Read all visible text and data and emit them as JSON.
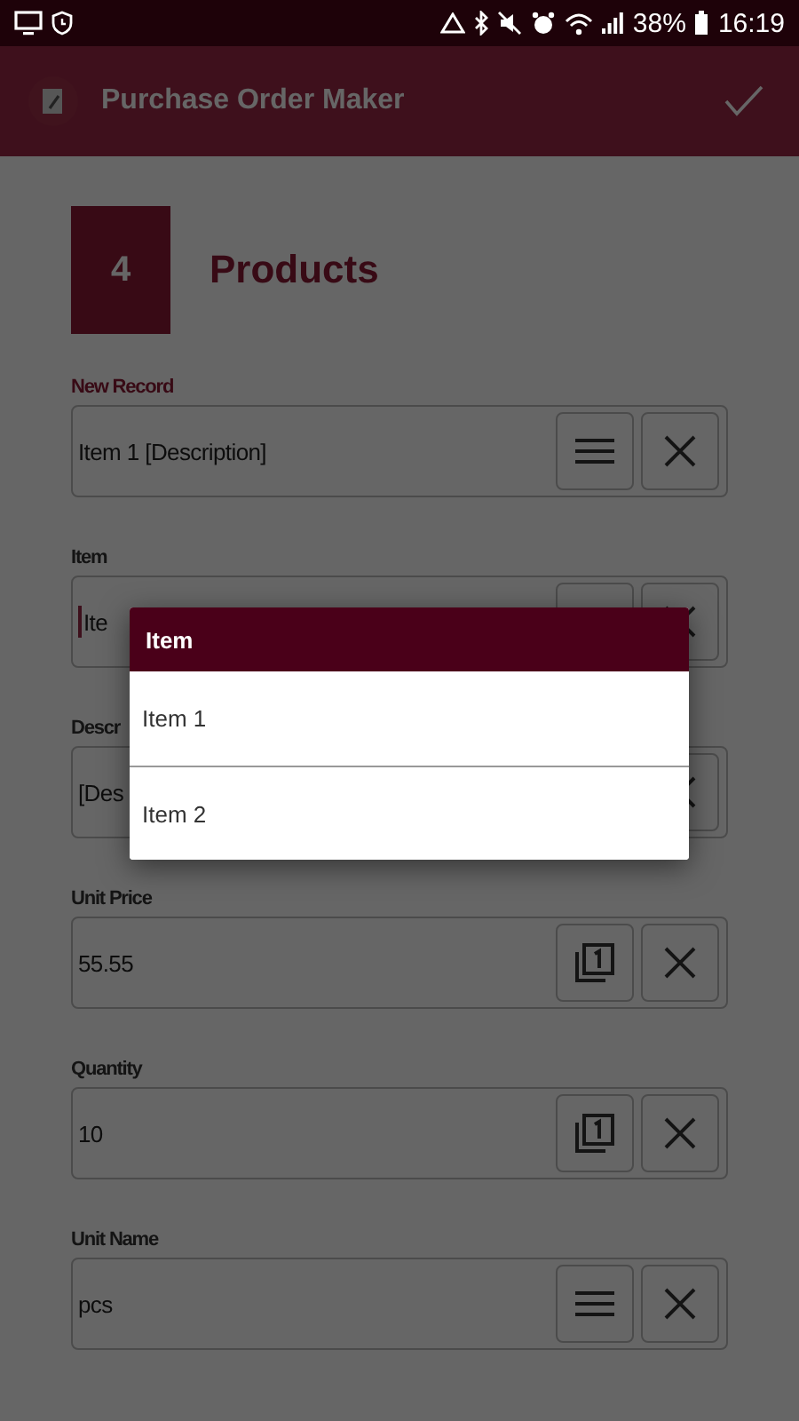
{
  "status_bar": {
    "battery": "38%",
    "time": "16:19"
  },
  "app_bar": {
    "title": "Purchase Order Maker"
  },
  "step": {
    "number": "4",
    "title": "Products"
  },
  "fields": [
    {
      "label": "New Record",
      "value": "Item 1 [Description]",
      "focused": false,
      "accent": true,
      "buttons": [
        {
          "kind": "list"
        },
        {
          "kind": "clear"
        }
      ]
    },
    {
      "label": "Item",
      "value": "Ite",
      "focused": true,
      "accent": false,
      "buttons": [
        {
          "kind": "covered"
        },
        {
          "kind": "clear"
        }
      ]
    },
    {
      "label": "Descr",
      "value": "[Des",
      "focused": false,
      "accent": false,
      "buttons": [
        {
          "kind": "clear"
        }
      ]
    },
    {
      "label": "Unit Price",
      "value": "55.55",
      "focused": false,
      "accent": false,
      "buttons": [
        {
          "kind": "copy"
        },
        {
          "kind": "clear"
        }
      ]
    },
    {
      "label": "Quantity",
      "value": "10",
      "focused": false,
      "accent": false,
      "buttons": [
        {
          "kind": "copy"
        },
        {
          "kind": "clear"
        }
      ]
    },
    {
      "label": "Unit Name",
      "value": "pcs",
      "focused": false,
      "accent": false,
      "buttons": [
        {
          "kind": "list"
        },
        {
          "kind": "clear"
        }
      ]
    }
  ],
  "dialog": {
    "title": "Item",
    "items": [
      {
        "label": "Item 1"
      },
      {
        "label": "Item 2"
      }
    ]
  }
}
